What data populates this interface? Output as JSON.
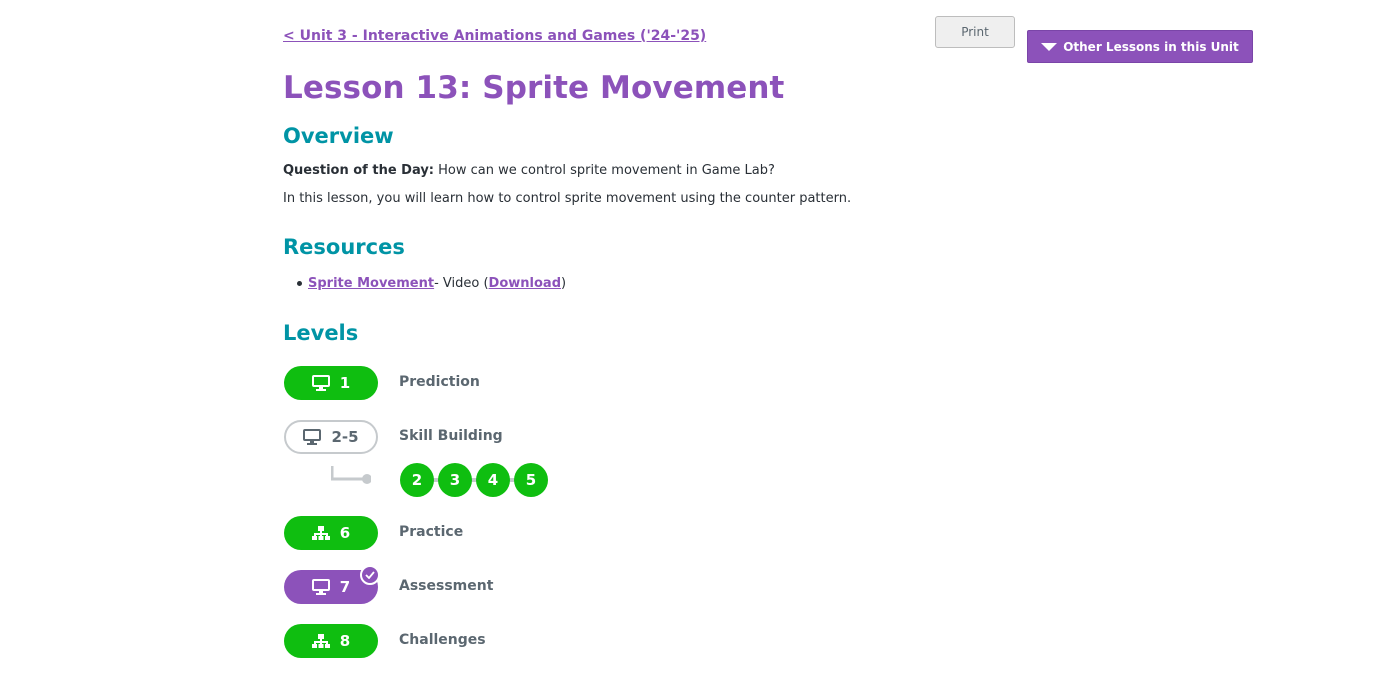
{
  "header": {
    "back_link": "< Unit 3 - Interactive Animations and Games ('24-'25)",
    "print_label": "Print",
    "other_lessons_label": "Other Lessons in this Unit"
  },
  "lesson": {
    "title": "Lesson 13: Sprite Movement"
  },
  "overview": {
    "heading": "Overview",
    "qotd_label": "Question of the Day:",
    "qotd_text": " How can we control sprite movement in Game Lab?",
    "description": "In this lesson, you will learn how to control sprite movement using the counter pattern."
  },
  "resources": {
    "heading": "Resources",
    "items": [
      {
        "link": "Sprite Movement",
        "type": " - Video (",
        "download": "Download",
        "close": ")"
      }
    ]
  },
  "levels": {
    "heading": "Levels",
    "items": [
      {
        "number": "1",
        "label": "Prediction",
        "icon": "monitor-icon",
        "status": "completed"
      },
      {
        "number": "2-5",
        "label": "Skill Building",
        "icon": "monitor-icon",
        "status": "group",
        "sublevels": [
          "2",
          "3",
          "4",
          "5"
        ]
      },
      {
        "number": "6",
        "label": "Practice",
        "icon": "hierarchy-icon",
        "status": "completed"
      },
      {
        "number": "7",
        "label": "Assessment",
        "icon": "monitor-icon",
        "status": "submitted"
      },
      {
        "number": "8",
        "label": "Challenges",
        "icon": "hierarchy-icon",
        "status": "completed"
      }
    ]
  },
  "colors": {
    "brand_purple": "#8c52ba",
    "heading_teal": "#0094a5",
    "level_green": "#0fbe10",
    "text_gray": "#5b6770"
  }
}
